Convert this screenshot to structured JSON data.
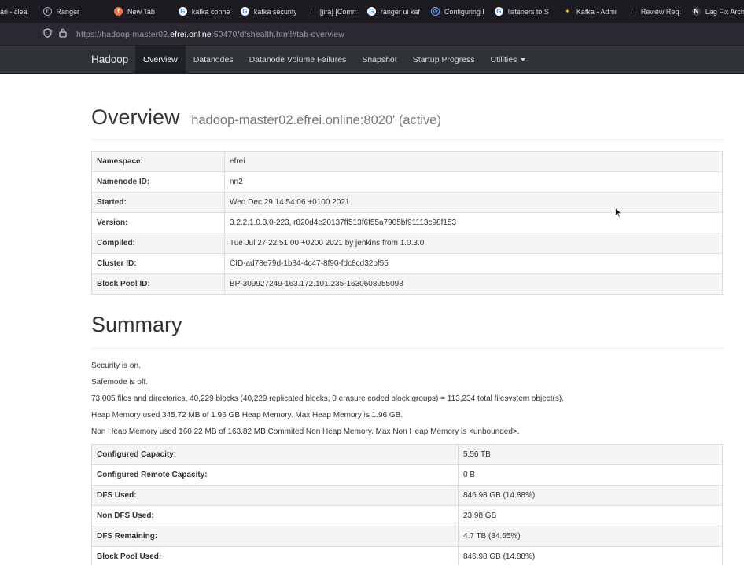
{
  "browser": {
    "tabs": [
      {
        "label": "ari - clea",
        "icon": "unknown-favicon"
      },
      {
        "label": "Ranger",
        "icon": "ranger-icon"
      },
      {
        "label": "New Tab",
        "icon": "firefox-icon"
      },
      {
        "label": "kafka connec",
        "icon": "google-icon"
      },
      {
        "label": "kafka security",
        "icon": "google-icon"
      },
      {
        "label": "[jira] [Comme",
        "icon": "jira-icon"
      },
      {
        "label": "ranger ui kafk",
        "icon": "google-icon"
      },
      {
        "label": "Configuring F",
        "icon": "configure-icon"
      },
      {
        "label": "listeners to S",
        "icon": "google-icon"
      },
      {
        "label": "Kafka - Admin",
        "icon": "kafka-icon"
      },
      {
        "label": "Review Reque",
        "icon": "jira-icon"
      },
      {
        "label": "Lag Fix Archiv",
        "icon": "n-icon"
      }
    ],
    "url_prefix": "https://hadoop-master02.",
    "url_host": "efrei.online",
    "url_suffix": ":50470/dfshealth.html#tab-overview"
  },
  "navbar": {
    "brand": "Hadoop",
    "links": [
      "Overview",
      "Datanodes",
      "Datanode Volume Failures",
      "Snapshot",
      "Startup Progress",
      "Utilities"
    ]
  },
  "overview": {
    "title": "Overview",
    "subtitle": "'hadoop-master02.efrei.online:8020' (active)",
    "rows": [
      {
        "key": "Namespace:",
        "value": "efrei"
      },
      {
        "key": "Namenode ID:",
        "value": "nn2"
      },
      {
        "key": "Started:",
        "value": "Wed Dec 29 14:54:06 +0100 2021"
      },
      {
        "key": "Version:",
        "value": "3.2.2.1.0.3.0-223, r820d4e20137ff513f6f55a7905bf91113c98f153"
      },
      {
        "key": "Compiled:",
        "value": "Tue Jul 27 22:51:00 +0200 2021 by jenkins from 1.0.3.0"
      },
      {
        "key": "Cluster ID:",
        "value": "CID-ad78e79d-1b84-4c47-8f90-fdc8cd32bf55"
      },
      {
        "key": "Block Pool ID:",
        "value": "BP-309927249-163.172.101.235-1630608955098"
      }
    ]
  },
  "summary": {
    "title": "Summary",
    "lines": [
      "Security is on.",
      "Safemode is off.",
      "73,005 files and directories, 40,229 blocks (40,229 replicated blocks, 0 erasure coded block groups) = 113,234 total filesystem object(s).",
      "Heap Memory used 345.72 MB of 1.96 GB Heap Memory. Max Heap Memory is 1.96 GB.",
      "Non Heap Memory used 160.22 MB of 163.82 MB Commited Non Heap Memory. Max Non Heap Memory is <unbounded>."
    ],
    "rows": [
      {
        "key": "Configured Capacity:",
        "value": "5.56 TB"
      },
      {
        "key": "Configured Remote Capacity:",
        "value": "0 B"
      },
      {
        "key": "DFS Used:",
        "value": "846.98 GB (14.88%)"
      },
      {
        "key": "Non DFS Used:",
        "value": "23.98 GB"
      },
      {
        "key": "DFS Remaining:",
        "value": "4.7 TB (84.65%)"
      },
      {
        "key": "Block Pool Used:",
        "value": "846.98 GB (14.88%)"
      }
    ]
  }
}
